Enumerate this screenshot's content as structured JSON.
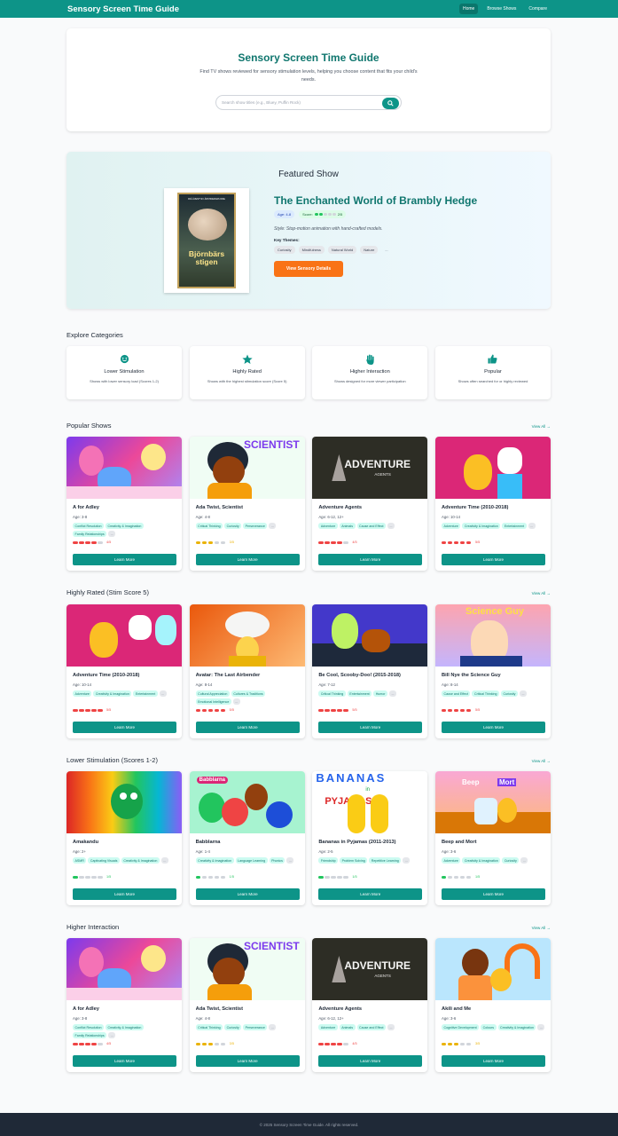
{
  "nav": {
    "brand": "Sensory Screen Time Guide",
    "links": [
      "Home",
      "Browse Shows",
      "Compare"
    ]
  },
  "hero": {
    "title": "Sensory Screen Time Guide",
    "subtitle": "Find TV shows reviewed for sensory stimulation levels, helping you choose content that fits your child's needs.",
    "search_placeholder": "Search show titles (e.g., Bluey, Puffin Rock)"
  },
  "featured": {
    "heading": "Featured Show",
    "poster_top_text": "PAÅ ÄVENTYR I ÅRSTIDERNAS RIKE",
    "poster_title": "Björnbärs stigen",
    "title": "The Enchanted World of Brambly Hedge",
    "age": "Age: 4-8",
    "score_label": "Score:",
    "score_value": "2/5",
    "score": 2,
    "style": "Style: Stop-motion animation with hand-crafted models.",
    "themes_label": "Key Themes:",
    "themes": [
      "Curiosity",
      "Mindfulness",
      "Natural World",
      "Nature",
      "..."
    ],
    "button": "View Sensory Details"
  },
  "categories": {
    "title": "Explore Categories",
    "items": [
      {
        "name": "Lower Stimulation",
        "desc": "Shows with lower sensory load (Scores 1-2)",
        "icon": "smile-icon"
      },
      {
        "name": "Highly Rated",
        "desc": "Shows with the highest stimulation score (Score 5)",
        "icon": "star-icon"
      },
      {
        "name": "Higher Interaction",
        "desc": "Shows designed for more viewer participation",
        "icon": "hand-icon"
      },
      {
        "name": "Popular",
        "desc": "Shows often searched for or highly reviewed",
        "icon": "thumbs-up-icon"
      }
    ]
  },
  "view_all": "View All →",
  "learn_more": "Learn More",
  "colors": {
    "accent": "#0d9488",
    "orange": "#f97316",
    "low": "#22c55e",
    "mid": "#eab308",
    "high": "#ef4444"
  },
  "sections": [
    {
      "title": "Popular Shows",
      "shows": [
        {
          "name": "A for Adley",
          "age": "Age: 3-8",
          "tags": [
            "Conflict Resolution",
            "Creativity & Imagination",
            "Family Relationships",
            "..."
          ],
          "score": 4,
          "score_text": "4/5"
        },
        {
          "name": "Ada Twist, Scientist",
          "age": "Age: 4-8",
          "tags": [
            "Critical Thinking",
            "Curiosity",
            "Perseverance",
            "..."
          ],
          "score": 3,
          "score_text": "3/5"
        },
        {
          "name": "Adventure Agents",
          "age": "Age: 6-12, 12+",
          "tags": [
            "Adventure",
            "Animals",
            "Cause and Effect",
            "..."
          ],
          "score": 4,
          "score_text": "4/5"
        },
        {
          "name": "Adventure Time (2010-2018)",
          "age": "Age: 10-14",
          "tags": [
            "Adventure",
            "Creativity & Imagination",
            "Entertainment",
            "..."
          ],
          "score": 5,
          "score_text": "5/5"
        }
      ]
    },
    {
      "title": "Highly Rated (Stim Score 5)",
      "shows": [
        {
          "name": "Adventure Time (2010-2018)",
          "age": "Age: 10-14",
          "tags": [
            "Adventure",
            "Creativity & Imagination",
            "Entertainment",
            "..."
          ],
          "score": 5,
          "score_text": "5/5"
        },
        {
          "name": "Avatar: The Last Airbender",
          "age": "Age: 8-14",
          "tags": [
            "Cultural Appreciation",
            "Cultures & Traditions",
            "Emotional Intelligence",
            "..."
          ],
          "score": 5,
          "score_text": "5/5"
        },
        {
          "name": "Be Cool, Scooby-Doo! (2015-2018)",
          "age": "Age: 7-12",
          "tags": [
            "Critical Thinking",
            "Entertainment",
            "Humor",
            "..."
          ],
          "score": 5,
          "score_text": "5/5"
        },
        {
          "name": "Bill Nye the Science Guy",
          "age": "Age: 8-14",
          "tags": [
            "Cause and Effect",
            "Critical Thinking",
            "Curiosity",
            "..."
          ],
          "score": 5,
          "score_text": "5/5"
        }
      ]
    },
    {
      "title": "Lower Stimulation (Scores 1-2)",
      "shows": [
        {
          "name": "Amakandu",
          "age": "Age: 2+",
          "tags": [
            "ASMR",
            "Captivating Visuals",
            "Creativity & Imagination",
            "..."
          ],
          "score": 1,
          "score_text": "1/5"
        },
        {
          "name": "Babblarna",
          "age": "Age: 1-4",
          "tags": [
            "Creativity & Imagination",
            "Language Learning",
            "Phonics",
            "..."
          ],
          "score": 1,
          "score_text": "1/5"
        },
        {
          "name": "Bananas in Pyjamas (2011-2013)",
          "age": "Age: 2-5",
          "tags": [
            "Friendship",
            "Problem Solving",
            "Repetitive Learning",
            "..."
          ],
          "score": 1,
          "score_text": "1/5"
        },
        {
          "name": "Beep and Mort",
          "age": "Age: 3-6",
          "tags": [
            "Adventure",
            "Creativity & Imagination",
            "Curiosity",
            "..."
          ],
          "score": 1,
          "score_text": "1/5"
        }
      ]
    },
    {
      "title": "Higher Interaction",
      "shows": [
        {
          "name": "A for Adley",
          "age": "Age: 3-8",
          "tags": [
            "Conflict Resolution",
            "Creativity & Imagination",
            "Family Relationships",
            "..."
          ],
          "score": 4,
          "score_text": "4/5"
        },
        {
          "name": "Ada Twist, Scientist",
          "age": "Age: 4-8",
          "tags": [
            "Critical Thinking",
            "Curiosity",
            "Perseverance",
            "..."
          ],
          "score": 3,
          "score_text": "3/5"
        },
        {
          "name": "Adventure Agents",
          "age": "Age: 6-12, 12+",
          "tags": [
            "Adventure",
            "Animals",
            "Cause and Effect",
            "..."
          ],
          "score": 4,
          "score_text": "4/5"
        },
        {
          "name": "Akili and Me",
          "age": "Age: 3-6",
          "tags": [
            "Cognitive Development",
            "Colours",
            "Creativity & Imagination",
            "..."
          ],
          "score": 3,
          "score_text": "3/5"
        }
      ]
    }
  ],
  "thumb_text": {
    "ada": "SCIENTIST",
    "agents_big": "ADVENTURE",
    "agents_small": "AGENTS",
    "bill": "Science Guy",
    "babblarna": "Babblarna",
    "bananas_top": "BANANAS",
    "bananas_in": "in",
    "bananas_bottom": "PYJAMAS",
    "beep": "Beep",
    "mort": "Mort"
  },
  "footer": "© 2025 Sensory Screen Time Guide. All rights reserved."
}
